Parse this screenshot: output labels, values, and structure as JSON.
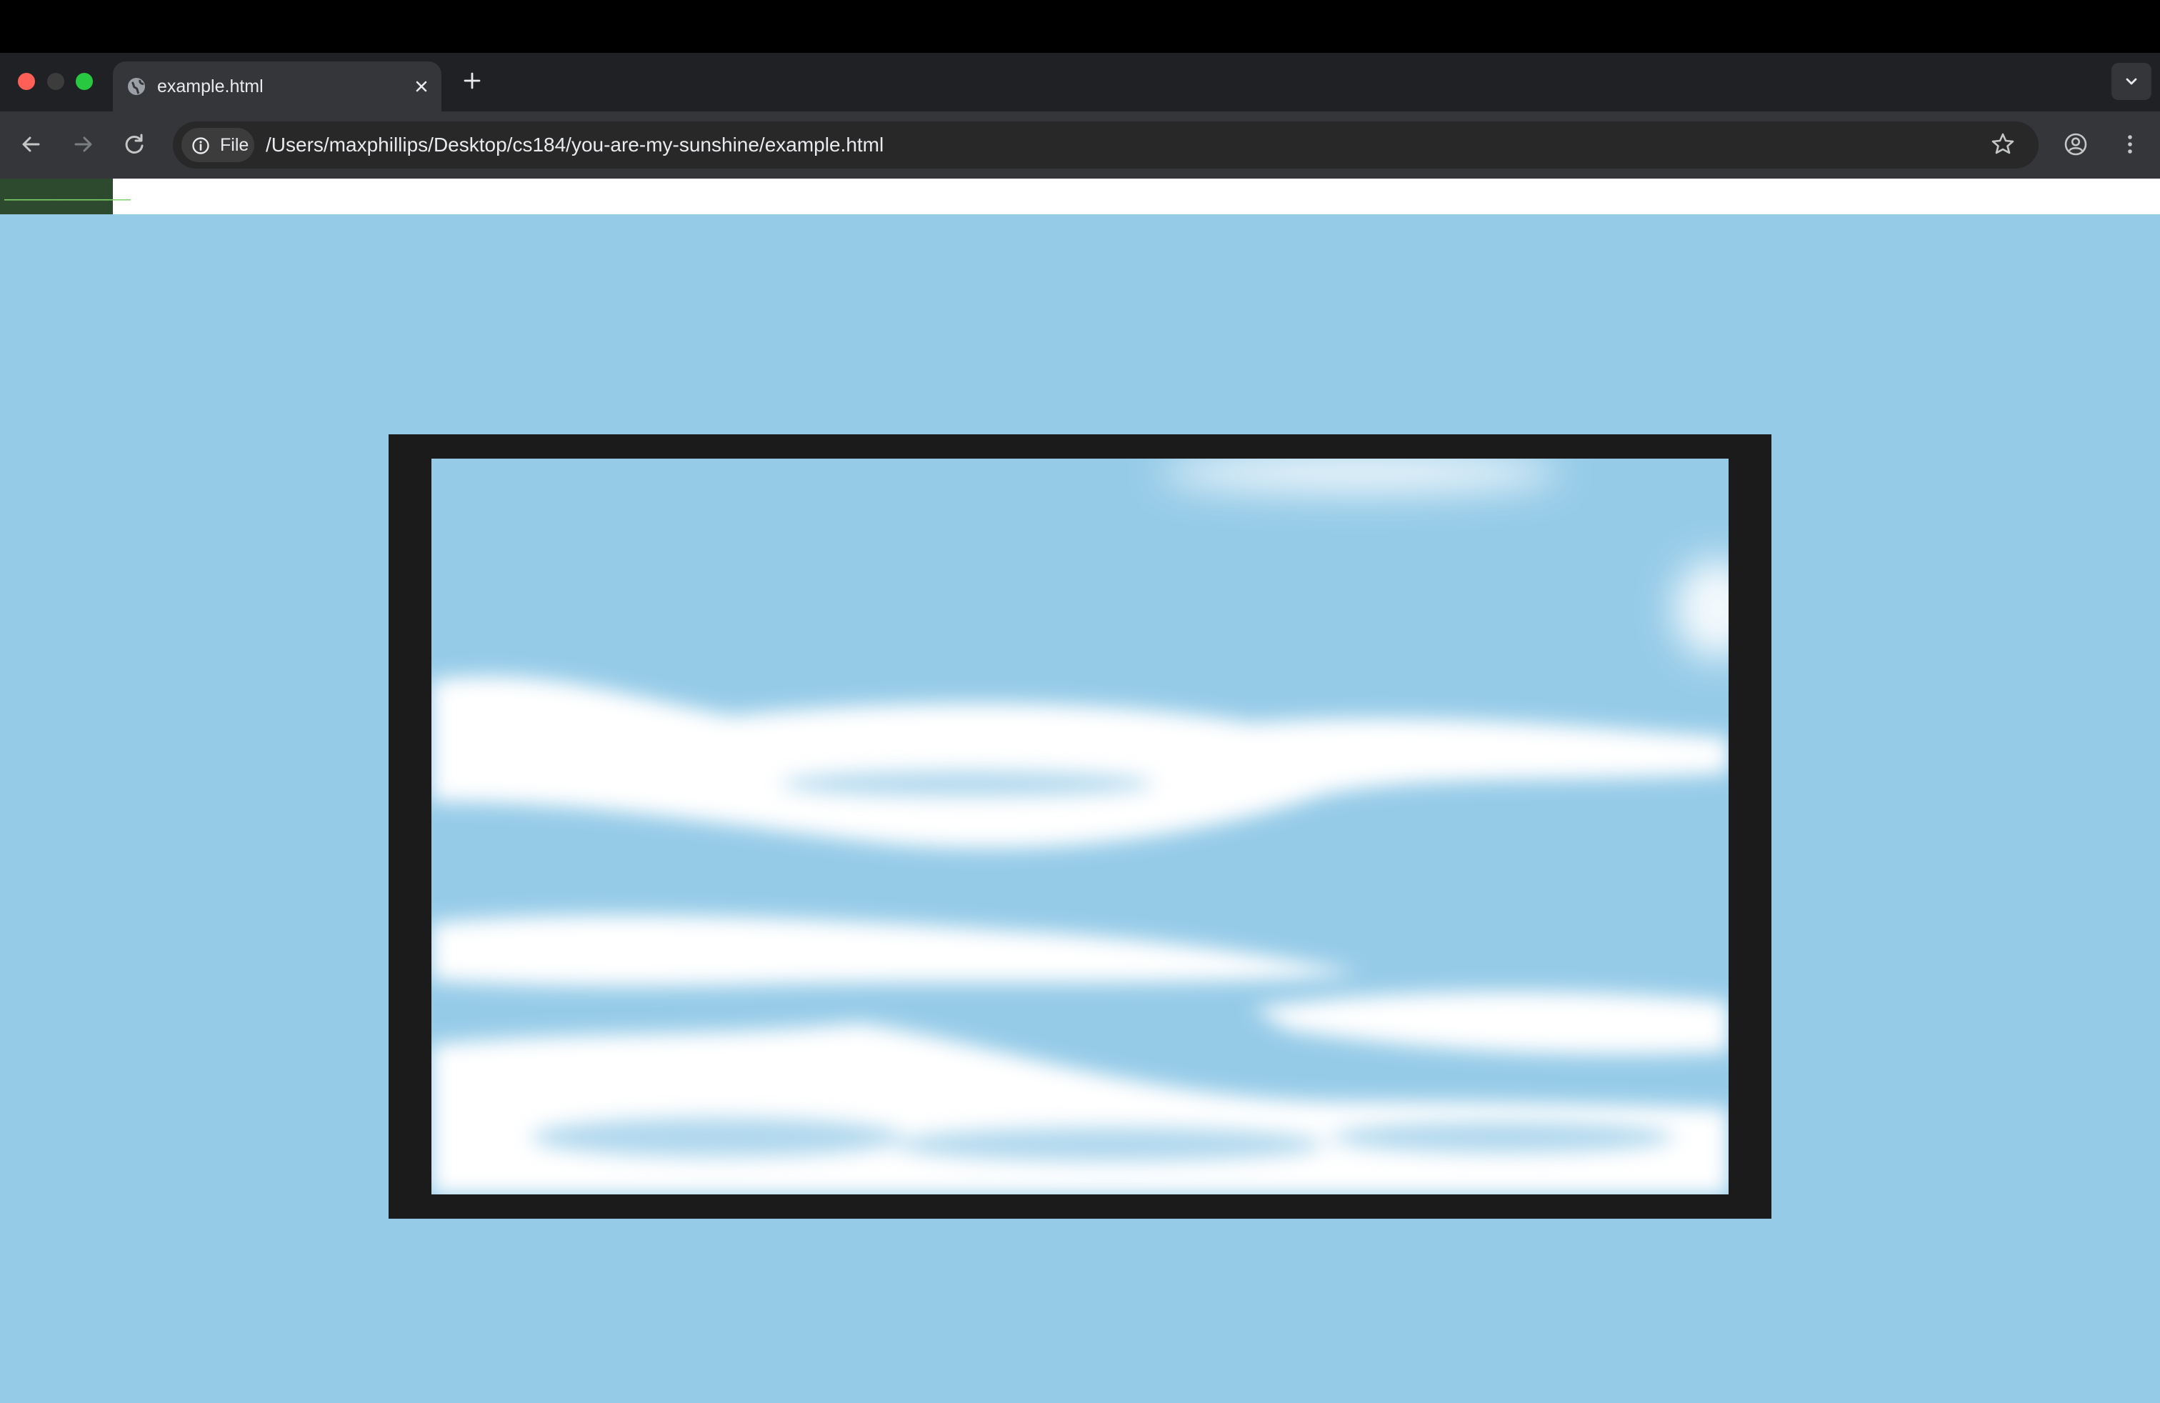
{
  "tab": {
    "title": "example.html"
  },
  "address_bar": {
    "scheme_label": "File",
    "url": "/Users/maxphillips/Desktop/cs184/you-are-my-sunshine/example.html"
  },
  "page": {
    "background_color": "#96cbe8",
    "frame_color": "#1b1b1b"
  },
  "icons": [
    "globe-icon",
    "close-icon",
    "plus-icon",
    "chevron-down-icon",
    "back-arrow-icon",
    "forward-arrow-icon",
    "reload-icon",
    "info-icon",
    "star-icon",
    "profile-icon",
    "kebab-menu-icon"
  ]
}
